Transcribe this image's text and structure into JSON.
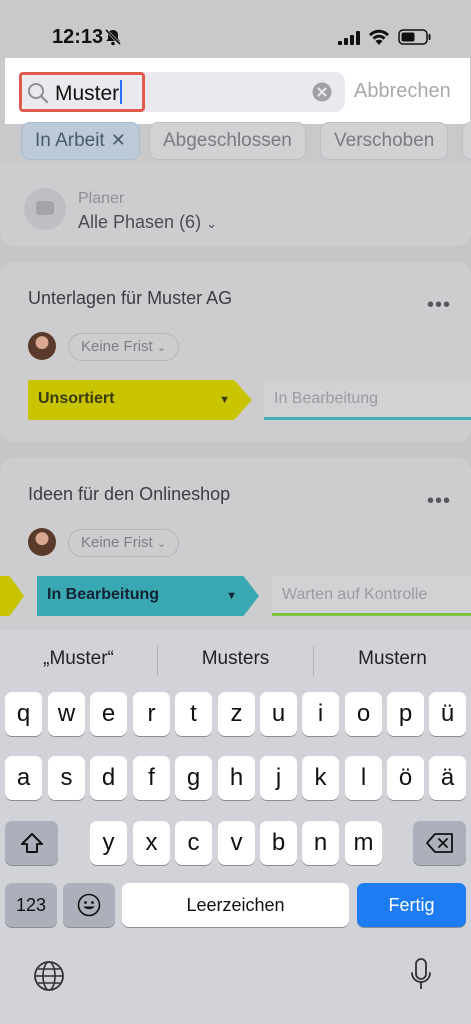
{
  "status_bar": {
    "time": "12:13"
  },
  "search": {
    "value": "Muster",
    "cancel_label": "Abbrechen"
  },
  "filters": [
    {
      "label": "In Arbeit",
      "active": true
    },
    {
      "label": "Abgeschlossen",
      "active": false
    },
    {
      "label": "Verschoben",
      "active": false
    }
  ],
  "planer": {
    "label": "Planer",
    "value": "Alle Phasen (6)"
  },
  "tasks": [
    {
      "title": "Unterlagen für Muster AG",
      "deadline": "Keine Frist",
      "stage": "Unsortiert",
      "next_stage": "In Bearbeitung"
    },
    {
      "title": "Ideen für den Onlineshop",
      "deadline": "Keine Frist",
      "stage": "In Bearbeitung",
      "next_stage": "Warten auf Kontrolle"
    }
  ],
  "keyboard": {
    "suggestions": [
      "„Muster“",
      "Musters",
      "Mustern"
    ],
    "row1": [
      "q",
      "w",
      "e",
      "r",
      "t",
      "z",
      "u",
      "i",
      "o",
      "p",
      "ü"
    ],
    "row2": [
      "a",
      "s",
      "d",
      "f",
      "g",
      "h",
      "j",
      "k",
      "l",
      "ö",
      "ä"
    ],
    "row3": [
      "y",
      "x",
      "c",
      "v",
      "b",
      "n",
      "m"
    ],
    "numbers_label": "123",
    "space_label": "Leerzeichen",
    "return_label": "Fertig"
  },
  "colors": {
    "accent": "#1d7cf2",
    "highlight": "#e05a4e",
    "stage_yellow": "#c8c400",
    "stage_teal": "#3aa8b2"
  }
}
